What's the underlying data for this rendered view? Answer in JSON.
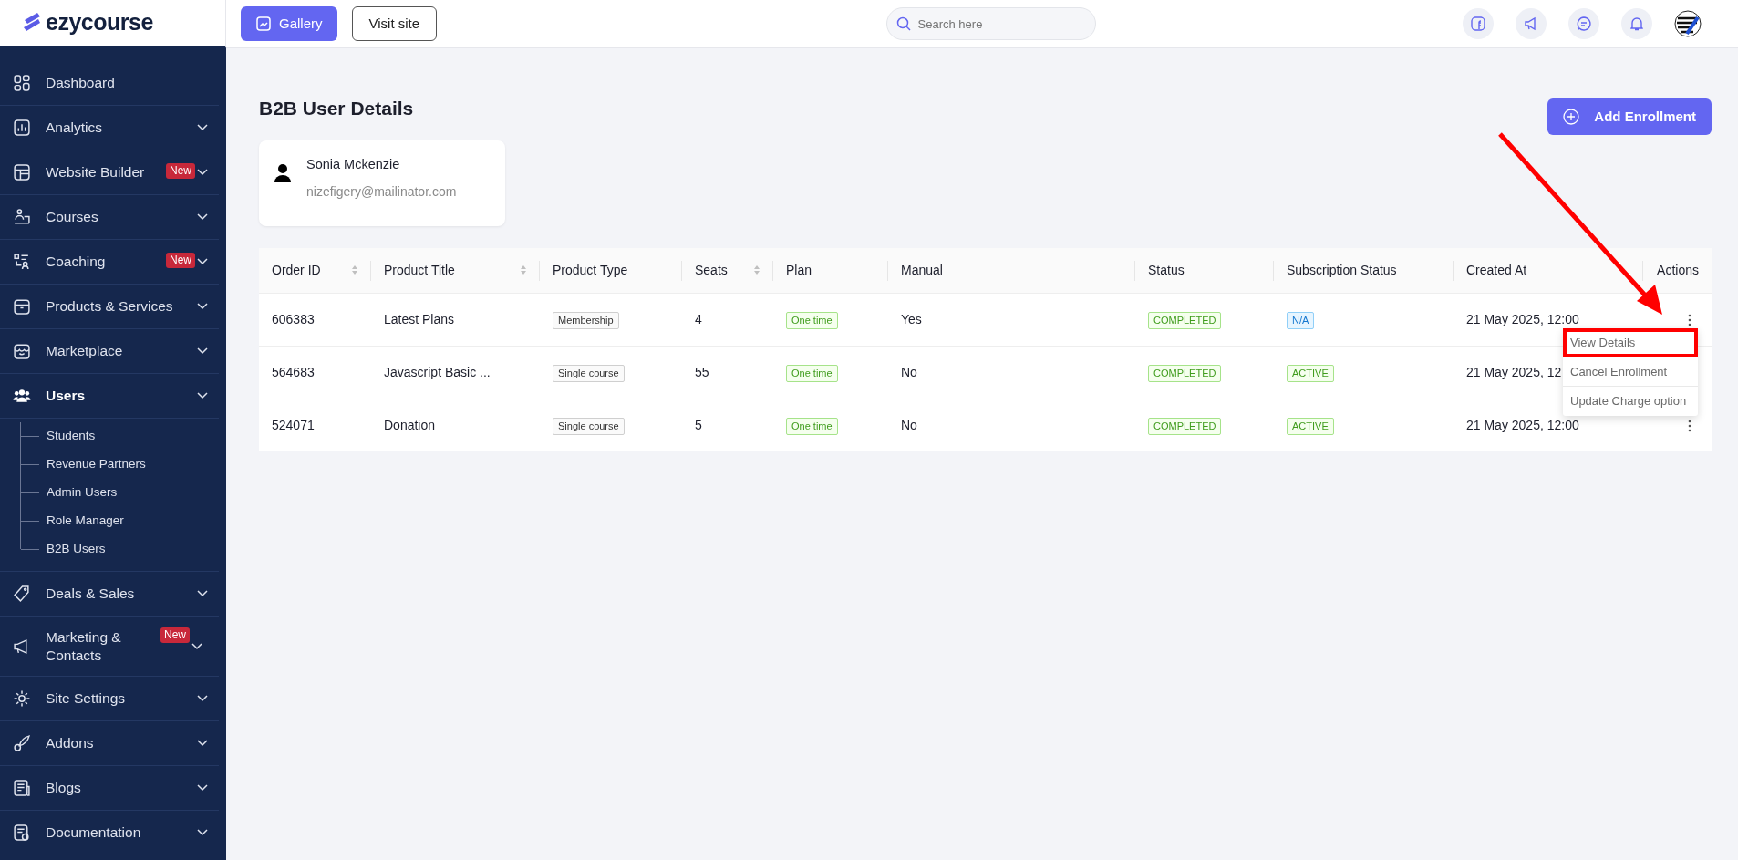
{
  "topbar": {
    "logo": "ezycourse",
    "gallery_button": "Gallery",
    "visit_button": "Visit site",
    "search": {
      "placeholder": "Search here"
    }
  },
  "sidebar": {
    "items": [
      {
        "label": "Dashboard",
        "collapsible": false,
        "selected": false
      },
      {
        "label": "Analytics",
        "collapsible": true,
        "selected": false
      },
      {
        "label": "Website Builder",
        "badge": "New",
        "collapsible": true,
        "selected": false
      },
      {
        "label": "Courses",
        "collapsible": true,
        "selected": false
      },
      {
        "label": "Coaching",
        "badge": "New",
        "collapsible": true,
        "selected": false
      },
      {
        "label": "Products & Services",
        "collapsible": true,
        "selected": false
      },
      {
        "label": "Marketplace",
        "collapsible": true,
        "selected": false
      },
      {
        "label": "Users",
        "collapsible": true,
        "selected": true,
        "children": [
          {
            "label": "Students"
          },
          {
            "label": "Revenue Partners"
          },
          {
            "label": "Admin Users"
          },
          {
            "label": "Role Manager"
          },
          {
            "label": "B2B Users"
          }
        ]
      },
      {
        "label": "Deals & Sales",
        "collapsible": true,
        "selected": false
      },
      {
        "label": "Marketing & Contacts",
        "badge": "New",
        "collapsible": true,
        "selected": false
      },
      {
        "label": "Site Settings",
        "collapsible": true,
        "selected": false
      },
      {
        "label": "Addons",
        "collapsible": true,
        "selected": false
      },
      {
        "label": "Blogs",
        "collapsible": true,
        "selected": false
      },
      {
        "label": "Documentation",
        "collapsible": true,
        "selected": false
      }
    ]
  },
  "page": {
    "title": "B2B User Details",
    "add_button": "Add Enrollment"
  },
  "user": {
    "name": "Sonia Mckenzie",
    "email": "nizefigery@mailinator.com"
  },
  "table": {
    "columns": [
      {
        "label": "Order ID",
        "sortable": true
      },
      {
        "label": "Product Title",
        "sortable": true
      },
      {
        "label": "Product Type",
        "sortable": false
      },
      {
        "label": "Seats",
        "sortable": true
      },
      {
        "label": "Plan",
        "sortable": false
      },
      {
        "label": "Manual",
        "sortable": false
      },
      {
        "label": "Status",
        "sortable": false
      },
      {
        "label": "Subscription Status",
        "sortable": false
      },
      {
        "label": "Created At",
        "sortable": false
      },
      {
        "label": "Actions",
        "sortable": false
      }
    ],
    "rows": [
      {
        "order_id": "606383",
        "title": "Latest Plans",
        "type": "Membership",
        "seats": "4",
        "plan": "One time",
        "manual": "Yes",
        "status": "COMPLETED",
        "subscription": {
          "text": "N/A",
          "kind": "info"
        },
        "created": "21 May 2025, 12:00"
      },
      {
        "order_id": "564683",
        "title": "Javascript Basic ...",
        "type": "Single course",
        "seats": "55",
        "plan": "One time",
        "manual": "No",
        "status": "COMPLETED",
        "subscription": {
          "text": "ACTIVE",
          "kind": "success"
        },
        "created": "21 May 2025, 12"
      },
      {
        "order_id": "524071",
        "title": "Donation",
        "type": "Single course",
        "seats": "5",
        "plan": "One time",
        "manual": "No",
        "status": "COMPLETED",
        "subscription": {
          "text": "ACTIVE",
          "kind": "success"
        },
        "created": "21 May 2025, 12:00"
      }
    ]
  },
  "menu": {
    "items": [
      {
        "label": "View Details",
        "highlighted": true
      },
      {
        "label": "Cancel Enrollment",
        "highlighted": false
      },
      {
        "label": "Update Charge option",
        "highlighted": false
      }
    ]
  }
}
